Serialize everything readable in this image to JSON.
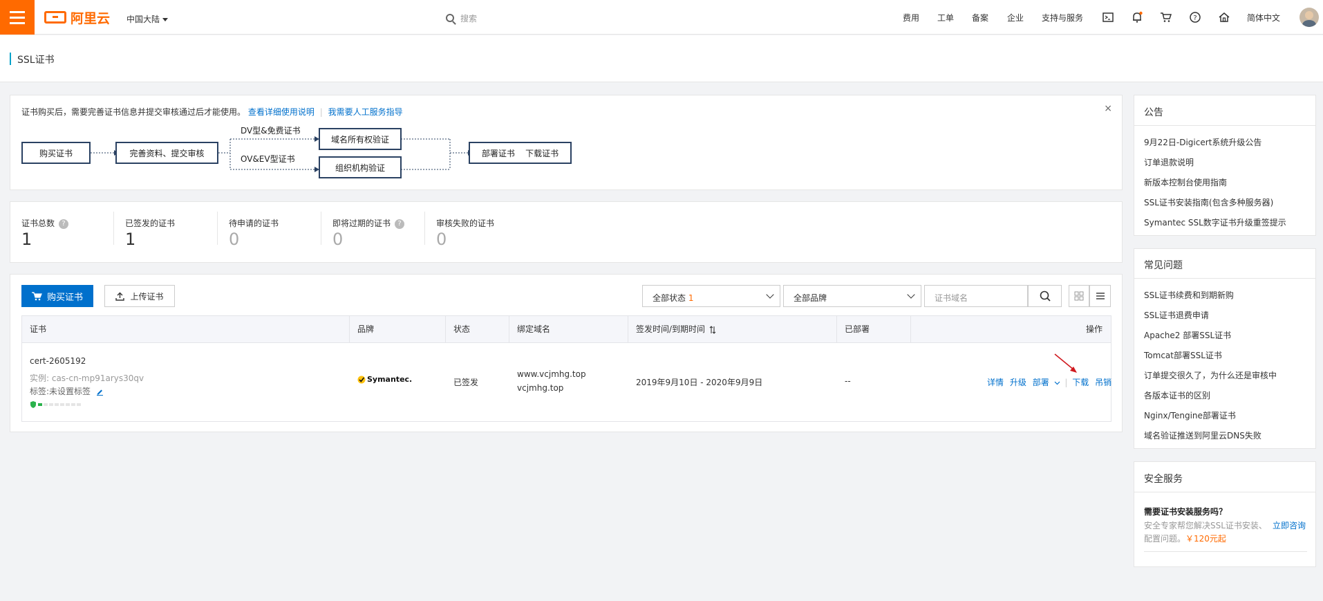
{
  "brand": {
    "name": "阿里云",
    "accent": "#ff6a00",
    "link": "#0070cc"
  },
  "header": {
    "region": "中国大陆",
    "search_placeholder": "搜索",
    "nav": [
      "费用",
      "工单",
      "备案",
      "企业",
      "支持与服务"
    ],
    "language": "简体中文",
    "icons": [
      "terminal-icon",
      "bell-icon",
      "cart-icon",
      "help-icon",
      "home-icon"
    ]
  },
  "page": {
    "title": "SSL证书"
  },
  "tips": {
    "text": "证书购买后，需要完善证书信息并提交审核通过后才能使用。",
    "link1": "查看详细使用说明",
    "link2": "我需要人工服务指导",
    "close": "×",
    "flow": {
      "step1": "购买证书",
      "step2": "完善资料、提交审核",
      "branch_dv": "DV型&免费证书",
      "branch_ov": "OV&EV型证书",
      "verify_domain": "域名所有权验证",
      "verify_org": "组织机构验证",
      "final": "部署证书    下载证书"
    }
  },
  "stats": [
    {
      "label": "证书总数",
      "value": "1",
      "help": true
    },
    {
      "label": "已签发的证书",
      "value": "1",
      "help": false
    },
    {
      "label": "待申请的证书",
      "value": "0",
      "help": false
    },
    {
      "label": "即将过期的证书",
      "value": "0",
      "help": true
    },
    {
      "label": "审核失败的证书",
      "value": "0",
      "help": false
    }
  ],
  "toolbar": {
    "buy": "购买证书",
    "upload": "上传证书",
    "status_filter": "全部状态",
    "status_count": "1",
    "brand_filter": "全部品牌",
    "domain_placeholder": "证书域名"
  },
  "table": {
    "headers": [
      "证书",
      "品牌",
      "状态",
      "绑定域名",
      "签发时间/到期时间",
      "已部署",
      "操作"
    ],
    "rows": [
      {
        "name": "cert-2605192",
        "instance": "实例: cas-cn-mp91arys30qv",
        "tag": "标签:未设置标签",
        "brand": "Symantec.",
        "status": "已签发",
        "domains": [
          "www.vcjmhg.top",
          "vcjmhg.top"
        ],
        "period": "2019年9月10日 - 2020年9月9日",
        "deployed": "--",
        "actions": [
          "详情",
          "升级",
          "部署",
          "下载",
          "吊销"
        ]
      }
    ]
  },
  "sidebar": {
    "announcement": {
      "title": "公告",
      "items": [
        "9月22日-Digicert系统升级公告",
        "订单退款说明",
        "新版本控制台使用指南",
        "SSL证书安装指南(包含多种服务器)",
        "Symantec SSL数字证书升级重签提示"
      ]
    },
    "faq": {
      "title": "常见问题",
      "items": [
        "SSL证书续费和到期新购",
        "SSL证书退费申请",
        "Apache2 部署SSL证书",
        "Tomcat部署SSL证书",
        "订单提交很久了，为什么还是审核中",
        "各版本证书的区别",
        "Nginx/Tengine部署证书",
        "域名验证推送到阿里云DNS失败"
      ]
    },
    "security": {
      "title": "安全服务",
      "q": "需要证书安装服务吗？",
      "desc1": "安全专家帮您解决SSL证书安装、",
      "desc2": "配置问题。",
      "price": "￥120元起",
      "consult": "立即咨询"
    }
  }
}
